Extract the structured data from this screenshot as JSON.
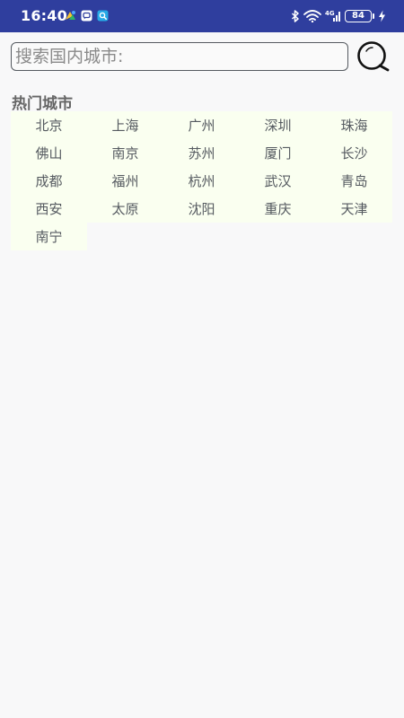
{
  "status_bar": {
    "time": "16:40",
    "network_label": "4G",
    "battery": "84",
    "app_icons": [
      "app-notification-icon",
      "message-notification-icon",
      "search-notification-icon"
    ],
    "colors": {
      "background": "#2f3e9e",
      "foreground": "#ffffff"
    }
  },
  "search": {
    "placeholder": "搜索国内城市:",
    "value": ""
  },
  "hot_cities": {
    "title": "热门城市",
    "cities": [
      "北京",
      "上海",
      "广州",
      "深圳",
      "珠海",
      "佛山",
      "南京",
      "苏州",
      "厦门",
      "长沙",
      "成都",
      "福州",
      "杭州",
      "武汉",
      "青岛",
      "西安",
      "太原",
      "沈阳",
      "重庆",
      "天津",
      "南宁"
    ],
    "colors": {
      "cell_background": "#fafff0",
      "cell_text": "#555a60"
    }
  }
}
